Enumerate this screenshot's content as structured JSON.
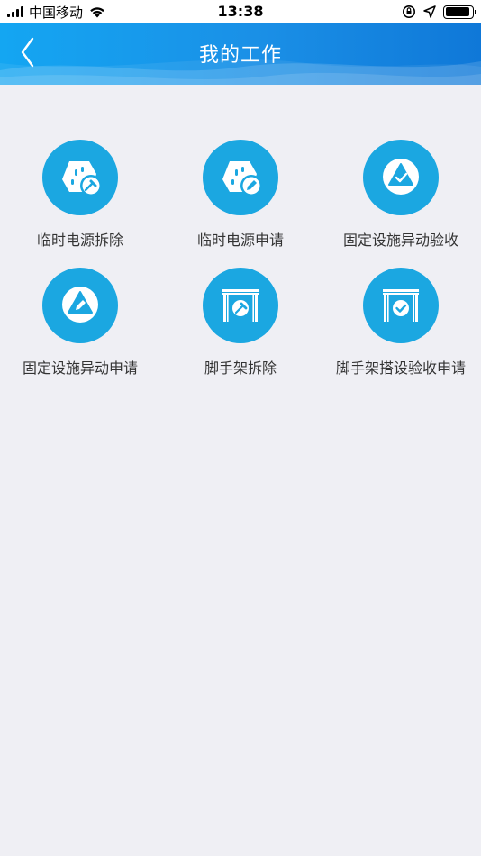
{
  "status_bar": {
    "carrier": "中国移动",
    "time": "13:38",
    "battery_level": 0.9
  },
  "header": {
    "title": "我的工作",
    "back_icon": "chevron-left-icon",
    "background_color": "#1a8fe6"
  },
  "work_items": [
    {
      "label": "临时电源拆除",
      "icon": "temp-power-remove-icon"
    },
    {
      "label": "临时电源申请",
      "icon": "temp-power-apply-icon"
    },
    {
      "label": "固定设施异动验收",
      "icon": "facility-change-accept-icon"
    },
    {
      "label": "固定设施异动申请",
      "icon": "facility-change-apply-icon"
    },
    {
      "label": "脚手架拆除",
      "icon": "scaffold-remove-icon"
    },
    {
      "label": "脚手架搭设验收申请",
      "icon": "scaffold-accept-apply-icon"
    }
  ],
  "colors": {
    "icon_circle": "#1ba7e1",
    "page_background": "#efeff4",
    "label_text": "#333333"
  }
}
